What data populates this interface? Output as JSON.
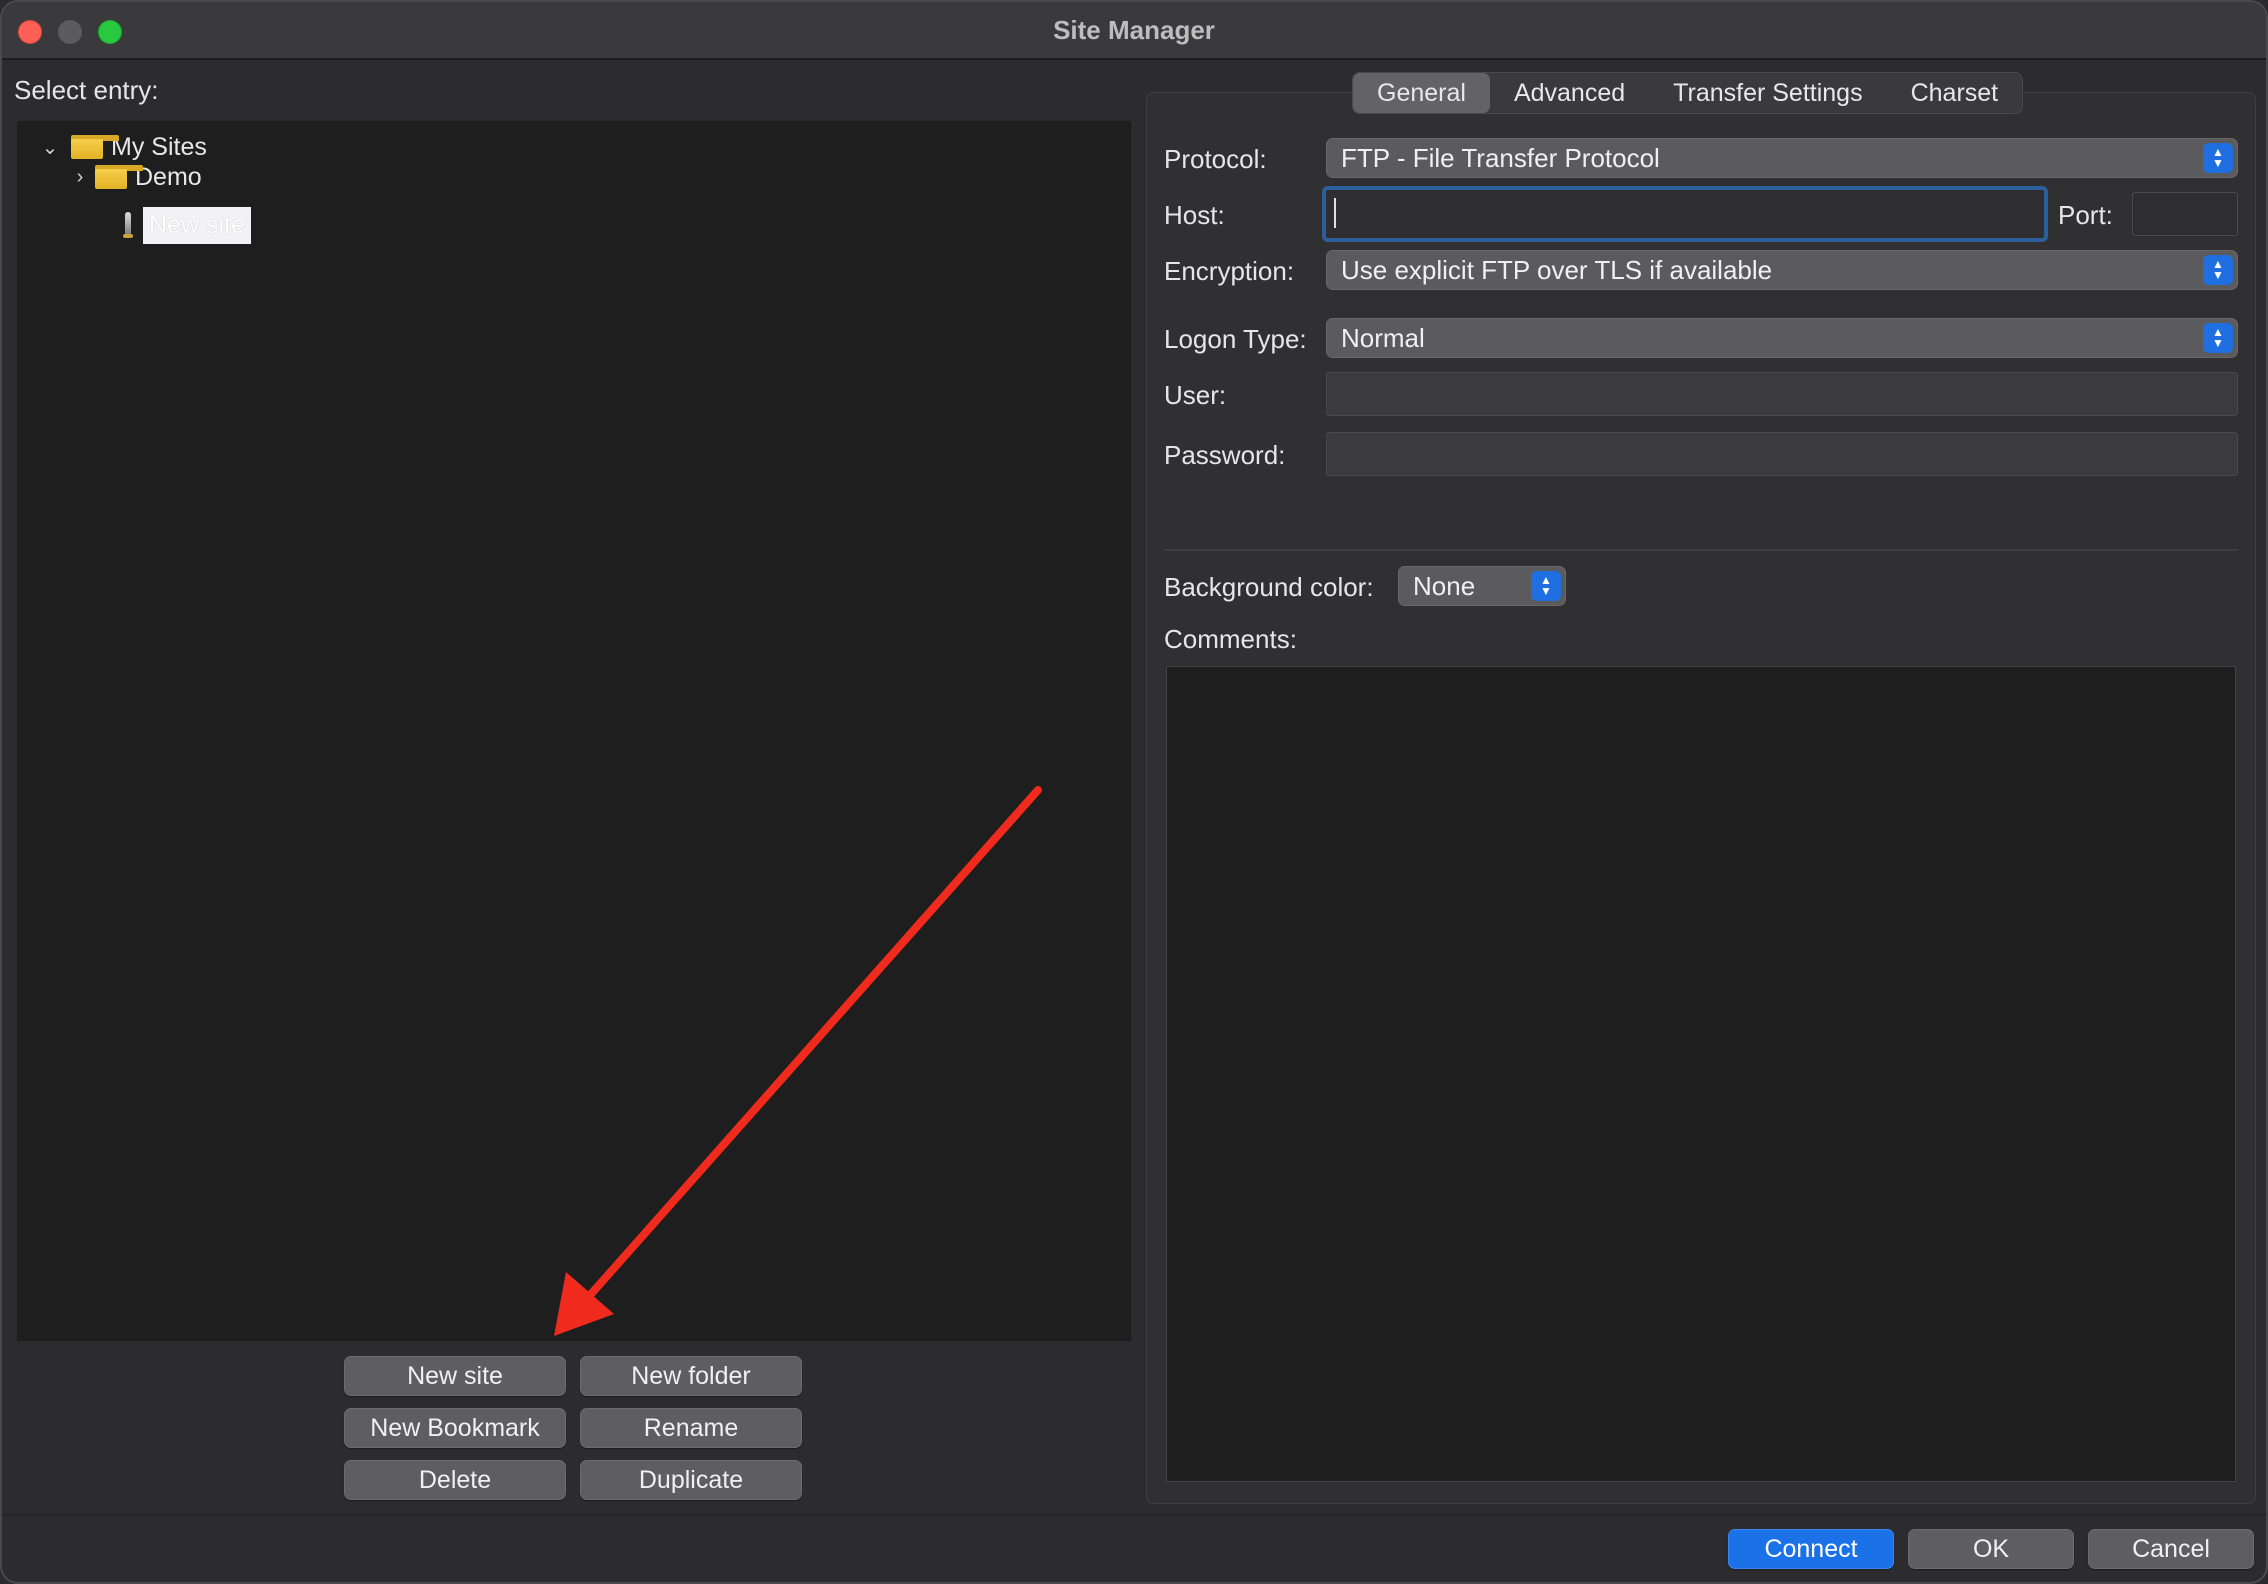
{
  "window": {
    "title": "Site Manager"
  },
  "left_panel": {
    "select_label": "Select entry:",
    "tree": [
      {
        "label": "My Sites",
        "expanded": true,
        "icon": "folder-icon"
      },
      {
        "label": "Demo",
        "expanded": false,
        "icon": "folder-icon"
      },
      {
        "label": "New site",
        "selected": true,
        "icon": "site-icon"
      }
    ],
    "buttons": {
      "new_site": "New site",
      "new_folder": "New folder",
      "new_bookmark": "New Bookmark",
      "rename": "Rename",
      "delete": "Delete",
      "duplicate": "Duplicate"
    }
  },
  "tabs": [
    "General",
    "Advanced",
    "Transfer Settings",
    "Charset"
  ],
  "active_tab": "General",
  "form": {
    "protocol_label": "Protocol:",
    "protocol_value": "FTP - File Transfer Protocol",
    "host_label": "Host:",
    "host_value": "",
    "port_label": "Port:",
    "port_value": "",
    "encryption_label": "Encryption:",
    "encryption_value": "Use explicit FTP over TLS if available",
    "logon_label": "Logon Type:",
    "logon_value": "Normal",
    "user_label": "User:",
    "user_value": "",
    "password_label": "Password:",
    "password_value": "",
    "bgcolor_label": "Background color:",
    "bgcolor_value": "None",
    "comments_label": "Comments:"
  },
  "footer": {
    "connect": "Connect",
    "ok": "OK",
    "cancel": "Cancel"
  },
  "colors": {
    "accent": "#1b72e8",
    "annotation_arrow": "#f02b1d"
  }
}
